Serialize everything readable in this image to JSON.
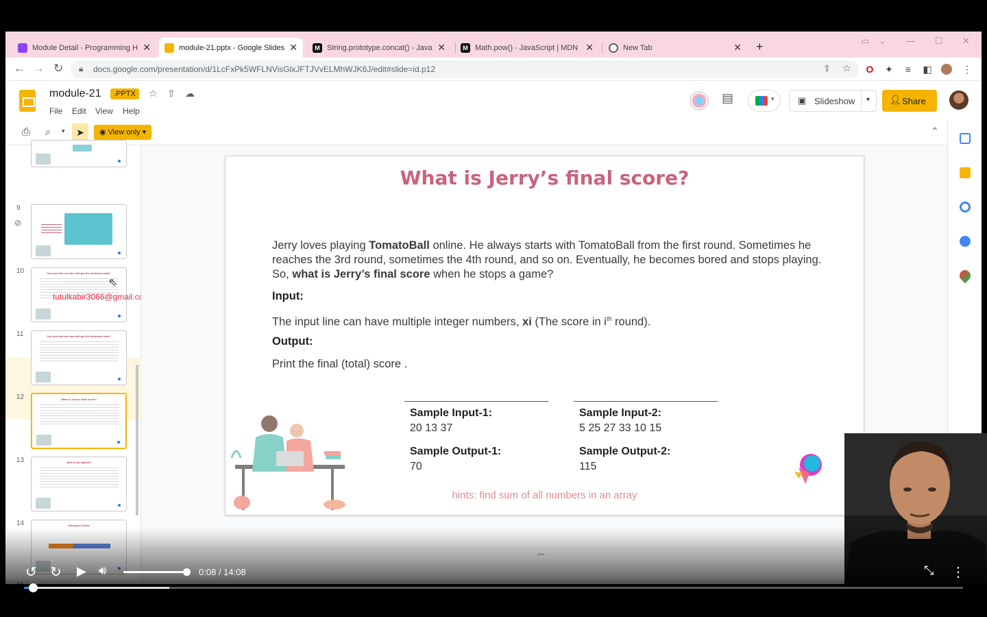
{
  "browser": {
    "tabs": [
      {
        "title": "Module Detail - Programming H⁣",
        "favicon": "phero-icon",
        "color": "#8e44ff"
      },
      {
        "title": "module-21.pptx - Google Slides",
        "favicon": "slides-icon",
        "color": "#f4b400"
      },
      {
        "title": "String.prototype.concat() - JavaSc",
        "favicon": "mdn-icon",
        "color": "#111111"
      },
      {
        "title": "Math.pow() - JavaScript | MDN",
        "favicon": "mdn-icon",
        "color": "#111111"
      },
      {
        "title": "New Tab",
        "favicon": "chrome-icon",
        "color": "#5f6368"
      }
    ],
    "url": "docs.google.com/presentation/d/1LcFxPk5WFLNVisGlxJFTJVvELMhWJK6J/edit#slide=id.p12"
  },
  "slides": {
    "doc_title": "module-21",
    "file_badge": ".PPTX",
    "menus": [
      "File",
      "Edit",
      "View",
      "Help"
    ],
    "slideshow_label": "Slideshow",
    "share_label": "Share",
    "view_only_label": "View only",
    "accent": "#f4b400"
  },
  "filmstrip": {
    "items": [
      {
        "num": "",
        "title": ""
      },
      {
        "num": "9",
        "title": ""
      },
      {
        "num": "10",
        "title": "Can you find out who will get the delicious cake?"
      },
      {
        "num": "11",
        "title": "Can you find out who will get the delicious cake?"
      },
      {
        "num": "12",
        "title": "What is Jerry's final score?"
      },
      {
        "num": "13",
        "title": "Who is the tallest?"
      },
      {
        "num": "14",
        "title": "Fibonacci Series"
      },
      {
        "num": "15",
        "title": ""
      }
    ],
    "email_overlay": "tutulkabir3066@gmail.com"
  },
  "slide": {
    "title": "What is Jerry’s final score?",
    "para1_a": "Jerry loves playing ",
    "para1_b": "TomatoBall",
    "para1_c": " online. He always starts with TomatoBall from the first round. Sometimes he reaches the 3rd round, sometimes the 4th round, and so on. Eventually, he becomes bored and stops playing. So, ",
    "para1_d": "what is Jerry’s final score",
    "para1_e": " when he stops a game?",
    "input_head": "Input:",
    "input_a": "The input line can have multiple integer numbers, ",
    "input_b": "xi",
    "input_c": " (The score in i",
    "input_sup": "th",
    "input_d": " round).",
    "output_head": "Output:",
    "output_text": "Print the final (total) score .",
    "sample_input_1_label": "Sample Input-1:",
    "sample_input_1": "20  13  37",
    "sample_output_1_label": "Sample Output-1:",
    "sample_output_1": "70",
    "sample_input_2_label": "Sample Input-2:",
    "sample_input_2": "5  25  27 33 10 15",
    "sample_output_2_label": "Sample Output-2:",
    "sample_output_2": "115",
    "hint": "hints: find sum of all numbers in an array",
    "title_color": "#c9637d",
    "hint_color": "#e88a8a"
  },
  "player": {
    "time": "0:08 / 14:08",
    "progress_fraction": 0.0095,
    "buffer_fraction": 0.155,
    "volume_fraction": 1.0,
    "progress_color": "#2196f3"
  }
}
